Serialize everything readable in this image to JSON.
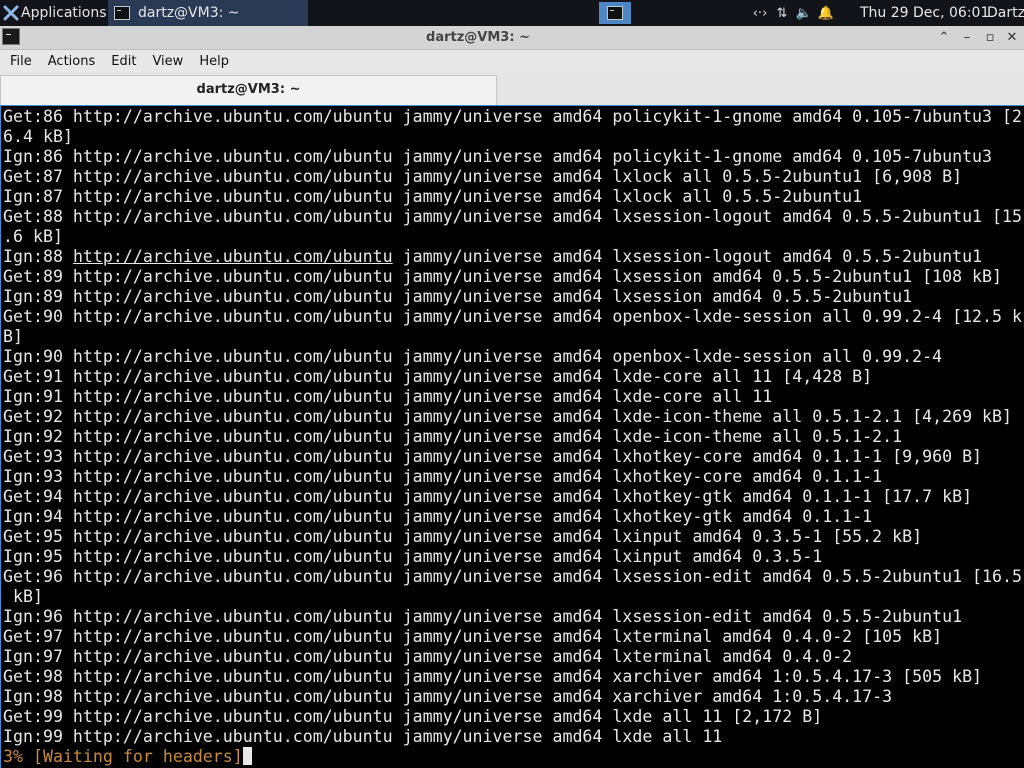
{
  "panel": {
    "applications_label": "Applications",
    "task_label": "dartz@VM3: ~",
    "clock": "Thu 29 Dec, 06:01",
    "user": "Dartz"
  },
  "window": {
    "title": "dartz@VM3: ~"
  },
  "menu": [
    "File",
    "Actions",
    "Edit",
    "View",
    "Help"
  ],
  "tab": {
    "label": "dartz@VM3: ~"
  },
  "terminal": {
    "lines": [
      "Get:86 http://archive.ubuntu.com/ubuntu jammy/universe amd64 policykit-1-gnome amd64 0.105-7ubuntu3 [2",
      "6.4 kB]",
      "Ign:86 http://archive.ubuntu.com/ubuntu jammy/universe amd64 policykit-1-gnome amd64 0.105-7ubuntu3",
      "Get:87 http://archive.ubuntu.com/ubuntu jammy/universe amd64 lxlock all 0.5.5-2ubuntu1 [6,908 B]",
      "Ign:87 http://archive.ubuntu.com/ubuntu jammy/universe amd64 lxlock all 0.5.5-2ubuntu1",
      "Get:88 http://archive.ubuntu.com/ubuntu jammy/universe amd64 lxsession-logout amd64 0.5.5-2ubuntu1 [15",
      ".6 kB]",
      "Ign:88 http://archive.ubuntu.com/ubuntu jammy/universe amd64 lxsession-logout amd64 0.5.5-2ubuntu1",
      "Get:89 http://archive.ubuntu.com/ubuntu jammy/universe amd64 lxsession amd64 0.5.5-2ubuntu1 [108 kB]",
      "Ign:89 http://archive.ubuntu.com/ubuntu jammy/universe amd64 lxsession amd64 0.5.5-2ubuntu1",
      "Get:90 http://archive.ubuntu.com/ubuntu jammy/universe amd64 openbox-lxde-session all 0.99.2-4 [12.5 k",
      "B]",
      "Ign:90 http://archive.ubuntu.com/ubuntu jammy/universe amd64 openbox-lxde-session all 0.99.2-4",
      "Get:91 http://archive.ubuntu.com/ubuntu jammy/universe amd64 lxde-core all 11 [4,428 B]",
      "Ign:91 http://archive.ubuntu.com/ubuntu jammy/universe amd64 lxde-core all 11",
      "Get:92 http://archive.ubuntu.com/ubuntu jammy/universe amd64 lxde-icon-theme all 0.5.1-2.1 [4,269 kB]",
      "Ign:92 http://archive.ubuntu.com/ubuntu jammy/universe amd64 lxde-icon-theme all 0.5.1-2.1",
      "Get:93 http://archive.ubuntu.com/ubuntu jammy/universe amd64 lxhotkey-core amd64 0.1.1-1 [9,960 B]",
      "Ign:93 http://archive.ubuntu.com/ubuntu jammy/universe amd64 lxhotkey-core amd64 0.1.1-1",
      "Get:94 http://archive.ubuntu.com/ubuntu jammy/universe amd64 lxhotkey-gtk amd64 0.1.1-1 [17.7 kB]",
      "Ign:94 http://archive.ubuntu.com/ubuntu jammy/universe amd64 lxhotkey-gtk amd64 0.1.1-1",
      "Get:95 http://archive.ubuntu.com/ubuntu jammy/universe amd64 lxinput amd64 0.3.5-1 [55.2 kB]",
      "Ign:95 http://archive.ubuntu.com/ubuntu jammy/universe amd64 lxinput amd64 0.3.5-1",
      "Get:96 http://archive.ubuntu.com/ubuntu jammy/universe amd64 lxsession-edit amd64 0.5.5-2ubuntu1 [16.5",
      " kB]",
      "Ign:96 http://archive.ubuntu.com/ubuntu jammy/universe amd64 lxsession-edit amd64 0.5.5-2ubuntu1",
      "Get:97 http://archive.ubuntu.com/ubuntu jammy/universe amd64 lxterminal amd64 0.4.0-2 [105 kB]",
      "Ign:97 http://archive.ubuntu.com/ubuntu jammy/universe amd64 lxterminal amd64 0.4.0-2",
      "Get:98 http://archive.ubuntu.com/ubuntu jammy/universe amd64 xarchiver amd64 1:0.5.4.17-3 [505 kB]",
      "Ign:98 http://archive.ubuntu.com/ubuntu jammy/universe amd64 xarchiver amd64 1:0.5.4.17-3",
      "Get:99 http://archive.ubuntu.com/ubuntu jammy/universe amd64 lxde all 11 [2,172 B]",
      "Ign:99 http://archive.ubuntu.com/ubuntu jammy/universe amd64 lxde all 11"
    ],
    "status": "3% [Waiting for headers]",
    "hover_link_line": 7,
    "hover_link_text": "http://archive.ubuntu.com/ubuntu"
  }
}
